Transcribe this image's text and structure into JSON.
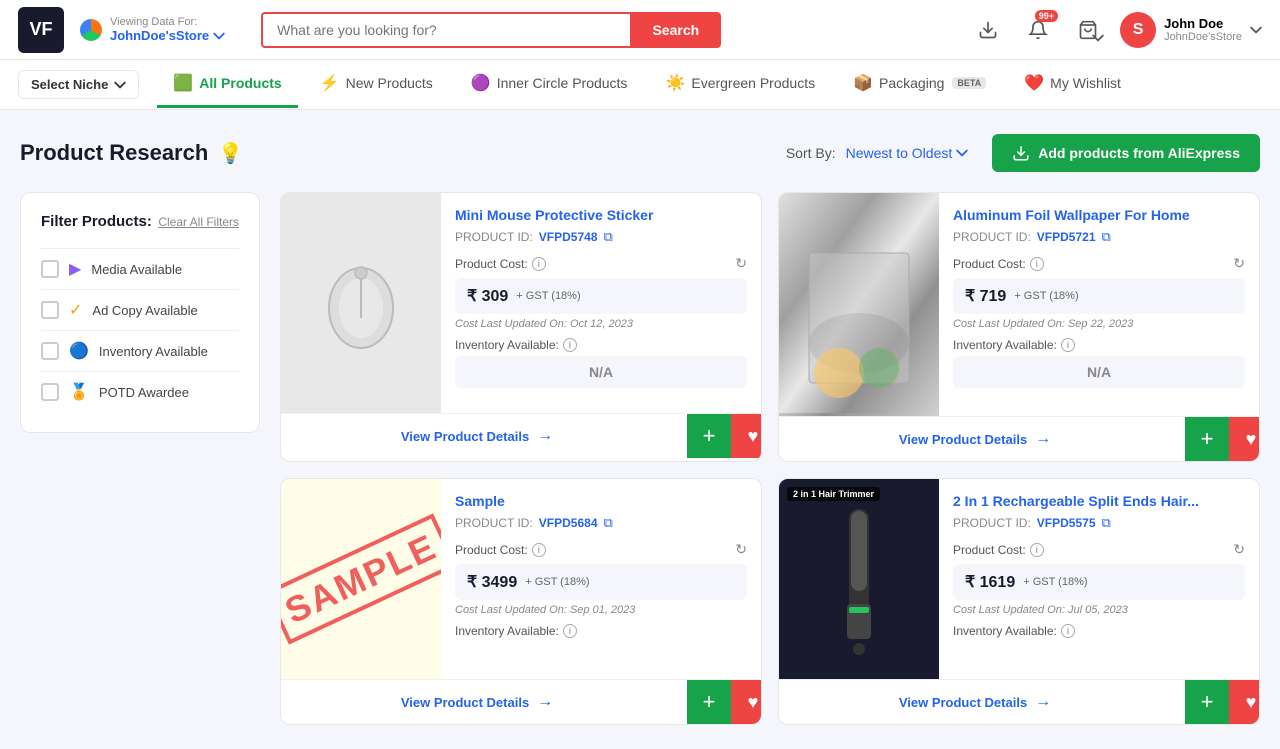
{
  "app": {
    "logo": "VF",
    "viewing_label": "Viewing Data For:",
    "store_name": "JohnDoe'sStore"
  },
  "header": {
    "search_placeholder": "What are you looking for?",
    "search_button": "Search",
    "notification_badge": "99+",
    "user": {
      "initial": "S",
      "name": "John Doe",
      "email": "JohnDoe'sStore"
    },
    "download_title": "Download"
  },
  "nav": {
    "niche_label": "Select Niche",
    "tabs": [
      {
        "id": "all",
        "label": "All Products",
        "icon": "🟩",
        "active": true
      },
      {
        "id": "new",
        "label": "New Products",
        "icon": "⚡"
      },
      {
        "id": "inner",
        "label": "Inner Circle Products",
        "icon": "🟣"
      },
      {
        "id": "evergreen",
        "label": "Evergreen Products",
        "icon": "☀️"
      },
      {
        "id": "packaging",
        "label": "Packaging",
        "icon": "📦",
        "beta": true
      },
      {
        "id": "wishlist",
        "label": "My Wishlist",
        "icon": "❤️"
      }
    ]
  },
  "main": {
    "page_title": "Product Research",
    "sort_label": "Sort By:",
    "sort_value": "Newest to Oldest",
    "add_products_btn": "Add products from AliExpress"
  },
  "filters": {
    "title": "Filter Products:",
    "clear_label": "Clear All Filters",
    "items": [
      {
        "id": "media",
        "label": "Media Available",
        "icon": "🟣"
      },
      {
        "id": "adcopy",
        "label": "Ad Copy Available",
        "icon": "🟡"
      },
      {
        "id": "inventory",
        "label": "Inventory Available",
        "icon": "🔵"
      },
      {
        "id": "potd",
        "label": "POTD Awardee",
        "icon": "🏅"
      }
    ]
  },
  "products": [
    {
      "id": "p1",
      "name": "Mini Mouse Protective Sticker",
      "product_id": "VFPD5748",
      "cost": "₹ 309",
      "gst": "+ GST (18%)",
      "cost_updated": "Cost Last Updated On: Oct 12, 2023",
      "inventory": "N/A",
      "inv_label": "Inventory Available:",
      "cost_label": "Product Cost:",
      "id_label": "PRODUCT ID:",
      "view_btn": "View Product Details",
      "type": "mouse"
    },
    {
      "id": "p2",
      "name": "Aluminum Foil Wallpaper For Home",
      "product_id": "VFPD5721",
      "cost": "₹ 719",
      "gst": "+ GST (18%)",
      "cost_updated": "Cost Last Updated On: Sep 22, 2023",
      "inventory": "N/A",
      "inv_label": "Inventory Available:",
      "cost_label": "Product Cost:",
      "id_label": "PRODUCT ID:",
      "view_btn": "View Product Details",
      "type": "foil"
    },
    {
      "id": "p3",
      "name": "Sample",
      "product_id": "VFPD5684",
      "cost": "₹ 3499",
      "gst": "+ GST (18%)",
      "cost_updated": "Cost Last Updated On: Sep 01, 2023",
      "inventory": "",
      "inv_label": "Inventory Available:",
      "cost_label": "Product Cost:",
      "id_label": "PRODUCT ID:",
      "view_btn": "View Product Details",
      "type": "sample"
    },
    {
      "id": "p4",
      "name": "2 In 1 Rechargeable Split Ends Hair...",
      "product_id": "VFPD5575",
      "cost": "₹ 1619",
      "gst": "+ GST (18%)",
      "cost_updated": "Cost Last Updated On: Jul 05, 2023",
      "inventory": "",
      "inv_label": "Inventory Available:",
      "cost_label": "Product Cost:",
      "id_label": "PRODUCT ID:",
      "view_btn": "View Product Details",
      "type": "hair",
      "badge": "2 in 1 Hair Trimmer"
    }
  ]
}
